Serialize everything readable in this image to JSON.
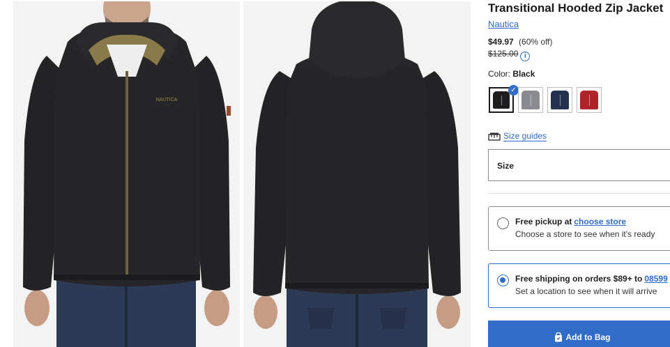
{
  "product": {
    "title": "Transitional Hooded Zip Jacket",
    "brand": "Nautica",
    "price": "$49.97",
    "discount": "(60% off)",
    "original_price": "$125.00",
    "info_icon": "i"
  },
  "gallery": {
    "front_logo_text": "NAUTICA"
  },
  "color": {
    "label": "Color:",
    "selected": "Black",
    "swatches": [
      {
        "name": "black",
        "hex": "#1e1e20",
        "selected": true
      },
      {
        "name": "grey",
        "hex": "#8a8b90",
        "selected": false
      },
      {
        "name": "navy",
        "hex": "#25324f",
        "selected": false
      },
      {
        "name": "red",
        "hex": "#b0232a",
        "selected": false
      }
    ]
  },
  "size": {
    "guide_label": "Size guides",
    "field_label": "Size"
  },
  "fulfillment": {
    "pickup": {
      "heading": "Free pickup at",
      "link": "choose store",
      "sub": "Choose a store to see when it's ready"
    },
    "shipping": {
      "heading": "Free shipping on orders $89+ to",
      "link": "08599",
      "sub": "Set a location to see when it will arrive"
    }
  },
  "cta": {
    "add_to_bag": "Add to Bag"
  },
  "colors": {
    "accent": "#2f6dc8"
  }
}
